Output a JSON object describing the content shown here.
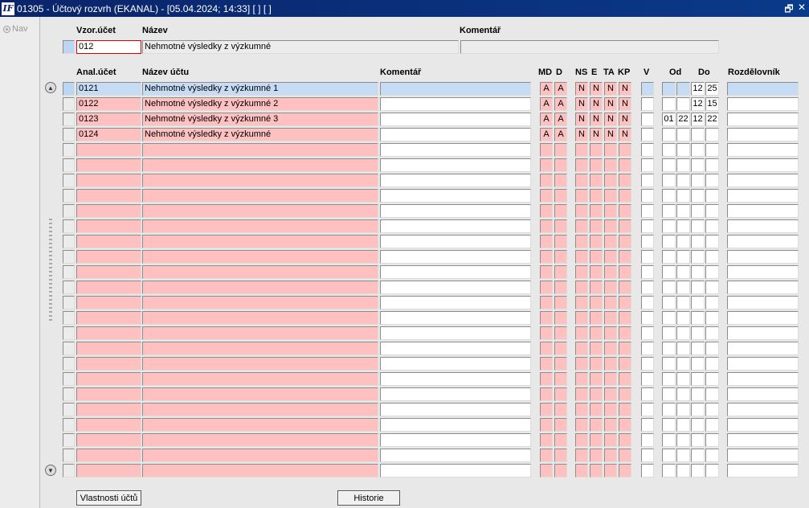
{
  "window": {
    "title": "01305 - Účtový rozvrh (EKANAL) - [05.04.2024; 14:33]  [ ]  [ ]",
    "app_icon_glyph": "IF",
    "restore_glyph": "🗗",
    "close_glyph": "✕"
  },
  "nav": {
    "label": "Nav"
  },
  "master": {
    "labels": {
      "code": "Vzor.účet",
      "name": "Název",
      "comment": "Komentář"
    },
    "code": "012",
    "name": "Nehmotné výsledky z výzkumné",
    "comment": ""
  },
  "detail": {
    "headers": {
      "code": "Anal.účet",
      "name": "Název účtu",
      "comment": "Komentář",
      "md": "MD",
      "d": "D",
      "ns": "NS",
      "e": "E",
      "ta": "TA",
      "kp": "KP",
      "v": "V",
      "od": "Od",
      "do": "Do",
      "distributor": "Rozdělovník"
    },
    "rows": [
      {
        "code": "0121",
        "name": "Nehmotné výsledky z výzkumné 1",
        "comment": "",
        "md": "A",
        "d": "A",
        "ns": "N",
        "e": "N",
        "ta": "N",
        "kp": "N",
        "v": "",
        "od1": "",
        "od2": "",
        "do1": "12",
        "do2": "25",
        "distributor": ""
      },
      {
        "code": "0122",
        "name": "Nehmotné výsledky z výzkumné 2",
        "comment": "",
        "md": "A",
        "d": "A",
        "ns": "N",
        "e": "N",
        "ta": "N",
        "kp": "N",
        "v": "",
        "od1": "",
        "od2": "",
        "do1": "12",
        "do2": "15",
        "distributor": ""
      },
      {
        "code": "0123",
        "name": "Nehmotné výsledky z výzkumné 3",
        "comment": "",
        "md": "A",
        "d": "A",
        "ns": "N",
        "e": "N",
        "ta": "N",
        "kp": "N",
        "v": "",
        "od1": "01",
        "od2": "22",
        "do1": "12",
        "do2": "22",
        "distributor": ""
      },
      {
        "code": "0124",
        "name": "Nehmotné výsledky z výzkumné",
        "comment": "",
        "md": "A",
        "d": "A",
        "ns": "N",
        "e": "N",
        "ta": "N",
        "kp": "N",
        "v": "",
        "od1": "",
        "od2": "",
        "do1": "",
        "do2": "",
        "distributor": ""
      }
    ],
    "empty_rows": 22
  },
  "buttons": {
    "properties": "Vlastnosti účtů",
    "history": "Historie"
  },
  "scroll": {
    "up_glyph": "▲",
    "down_glyph": "▼"
  }
}
